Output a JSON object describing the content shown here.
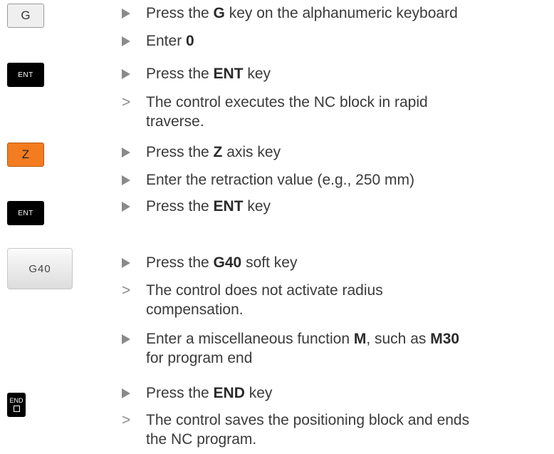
{
  "keys": {
    "g": "G",
    "ent1": "ENT",
    "z": "Z",
    "ent2": "ENT",
    "g40": "G40",
    "end": "END"
  },
  "steps": [
    {
      "type": "action",
      "pre": "Press the ",
      "bold": "G",
      "post": " key on the alphanumeric keyboard"
    },
    {
      "type": "action",
      "pre": "Enter ",
      "bold": "0",
      "post": ""
    },
    {
      "type": "action",
      "pre": "Press the ",
      "bold": "ENT",
      "post": " key"
    },
    {
      "type": "result",
      "line1": "The control executes the NC block in rapid",
      "line2": "traverse."
    },
    {
      "type": "action",
      "pre": "Press the ",
      "bold": "Z",
      "post": " axis key"
    },
    {
      "type": "action",
      "text": "Enter the retraction value (e.g., 250 mm)"
    },
    {
      "type": "action",
      "pre": "Press the ",
      "bold": "ENT",
      "post": " key"
    },
    {
      "type": "action",
      "pre": "Press the ",
      "bold": "G40",
      "post": " soft key"
    },
    {
      "type": "result",
      "line1": "The control does not activate radius",
      "line2": "compensation."
    },
    {
      "type": "action",
      "pre": "Enter a miscellaneous function ",
      "bold": "M",
      "mid": ", such as ",
      "bold2": "M30",
      "line2": "for program end"
    },
    {
      "type": "action",
      "pre": "Press the ",
      "bold": "END",
      "post": " key"
    },
    {
      "type": "result",
      "line1": "The control saves the positioning block and ends",
      "line2": "the NC program."
    }
  ],
  "result_mark": ">"
}
